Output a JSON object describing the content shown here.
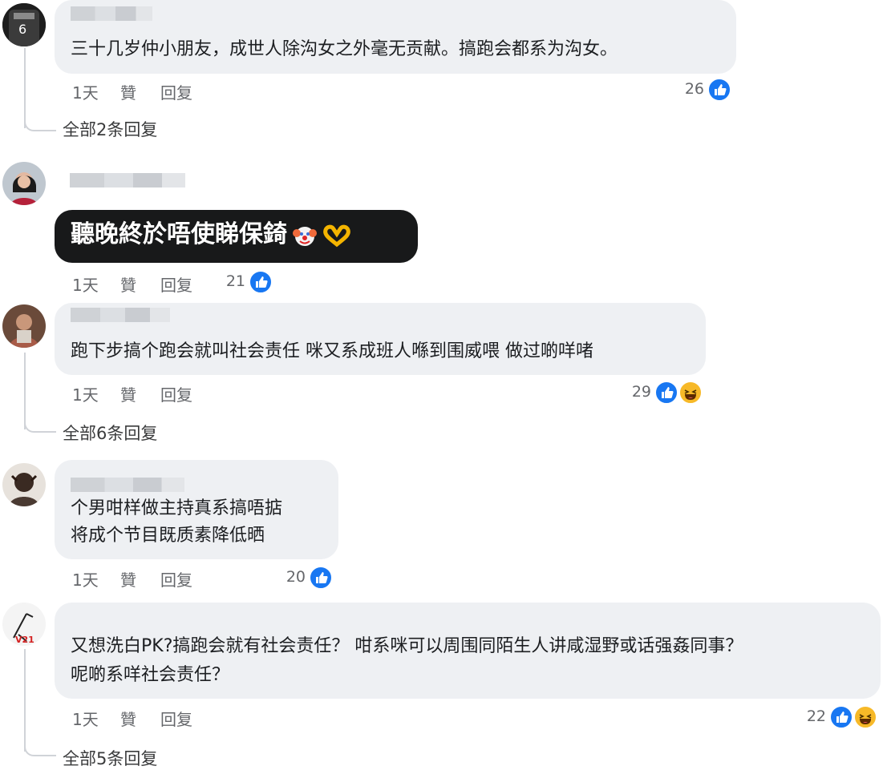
{
  "actions": {
    "time": "1天",
    "like": "贊",
    "reply": "回复"
  },
  "comments": [
    {
      "text": "三十几岁仲小朋友，成世人除沟女之外毫无贡献。搞跑会都系为沟女。",
      "likes": "26",
      "view_replies": "全部2条回复"
    },
    {
      "text": "聽晚終於唔使睇保錡",
      "likes": "21"
    },
    {
      "text": "跑下步搞个跑会就叫社会责任 咪又系成班人喺到围威喂 做过啲咩啫",
      "likes": "29",
      "view_replies": "全部6条回复"
    },
    {
      "line1": "个男咁样做主持真系搞唔掂",
      "line2": "将成个节目既质素降低晒",
      "likes": "20"
    },
    {
      "line1": "又想洗白PK?搞跑会就有社会责任？ 咁系咪可以周围同陌生人讲咸湿野或话强姦同事？",
      "line2": "呢啲系咩社会责任？",
      "likes": "22",
      "view_replies": "全部5条回复"
    }
  ]
}
